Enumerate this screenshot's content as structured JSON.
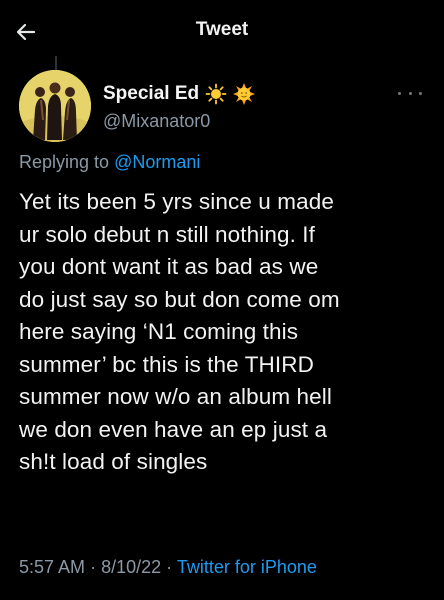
{
  "header": {
    "title": "Tweet",
    "back_icon": "arrow-left-icon"
  },
  "author": {
    "display_name": "Special Ed",
    "handle": "@Mixanator0",
    "emojis": [
      "sun-icon",
      "sun-face-icon"
    ]
  },
  "reply": {
    "prefix": "Replying to",
    "mention": "@Normani"
  },
  "tweet": {
    "lines": [
      "Yet its been 5 yrs since u made",
      "ur solo debut n still nothing. If",
      "you dont want it as bad as we",
      "do just say so but don come om",
      "here saying ‘N1 coming this",
      "summer’ bc this is the THIRD",
      "summer now w/o an album hell",
      "we don even have an ep just a",
      "sh!t load of singles"
    ]
  },
  "meta": {
    "time": "5:57 AM",
    "sep1": "·",
    "date": "8/10/22",
    "sep2": "·",
    "source": "Twitter for iPhone"
  },
  "colors": {
    "background": "#000000",
    "link": "#1d9bf0",
    "secondary": "#8b98a5"
  }
}
